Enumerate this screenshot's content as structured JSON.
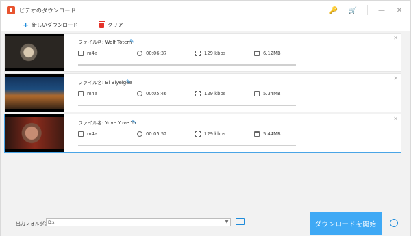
{
  "window": {
    "title": "ビデオのダウンロード",
    "buttons": {
      "key": "🔑",
      "cart": "🛒",
      "minimize": "—",
      "close": "✕"
    }
  },
  "toolbar": {
    "new_download": "新しいダウンロード",
    "clear": "クリア"
  },
  "colors": {
    "accent": "#3fa9f5",
    "brand": "#e8542f",
    "selected_border": "#4aa5e6"
  },
  "items": [
    {
      "filename": "ファイル名: Wolf Totem",
      "format": "m4a",
      "duration": "00:06:37",
      "bitrate": "129 kbps",
      "size": "6.12MB",
      "selected": false
    },
    {
      "filename": "ファイル名: Bi Biyelgee",
      "format": "m4a",
      "duration": "00:05:46",
      "bitrate": "129 kbps",
      "size": "5.34MB",
      "selected": false
    },
    {
      "filename": "ファイル名: Yuve Yuve Yu",
      "format": "m4a",
      "duration": "00:05:52",
      "bitrate": "129 kbps",
      "size": "5.44MB",
      "selected": true
    }
  ],
  "output": {
    "label": "出力フォルダ：",
    "path": "D:\\"
  },
  "start_button": "ダウンロードを開始"
}
